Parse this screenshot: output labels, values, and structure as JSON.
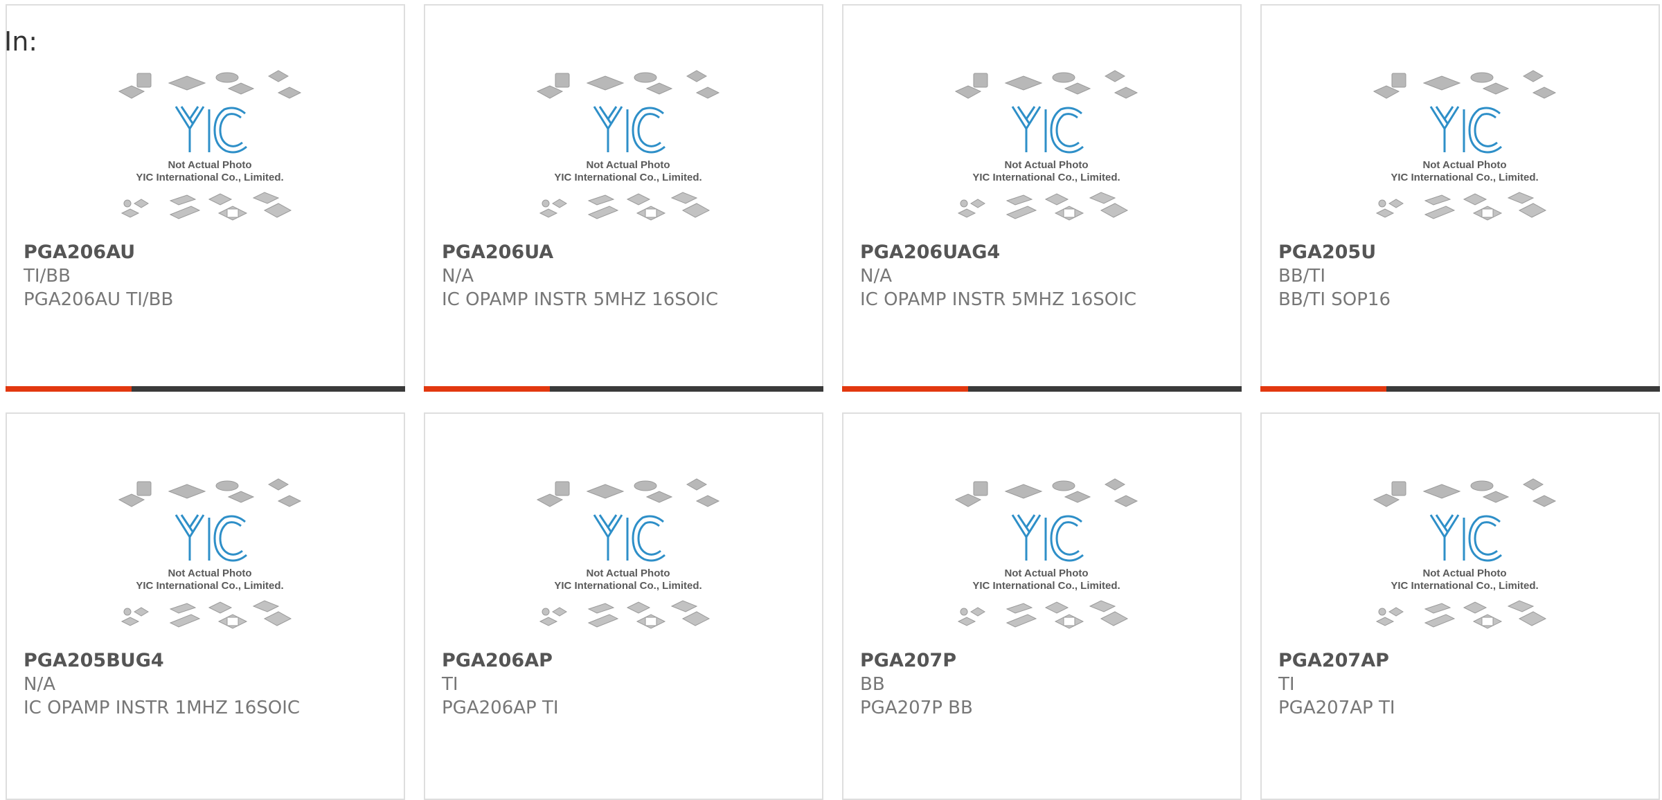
{
  "header": {
    "label": "In:"
  },
  "colors": {
    "accent": "#e2380f",
    "bar": "#3a3a3a",
    "logo": "#2e8fc8"
  },
  "watermark": {
    "logo_text": "YIC",
    "line1": "Not Actual Photo",
    "line2": "YIC International Co., Limited."
  },
  "products": [
    {
      "part": "PGA206AU",
      "manufacturer": "TI/BB",
      "description": "PGA206AU TI/BB"
    },
    {
      "part": "PGA206UA",
      "manufacturer": "N/A",
      "description": "IC OPAMP INSTR 5MHZ 16SOIC"
    },
    {
      "part": "PGA206UAG4",
      "manufacturer": "N/A",
      "description": "IC OPAMP INSTR 5MHZ 16SOIC"
    },
    {
      "part": "PGA205U",
      "manufacturer": "BB/TI",
      "description": "BB/TI SOP16"
    },
    {
      "part": "PGA205BUG4",
      "manufacturer": "N/A",
      "description": "IC OPAMP INSTR 1MHZ 16SOIC"
    },
    {
      "part": "PGA206AP",
      "manufacturer": "TI",
      "description": "PGA206AP TI"
    },
    {
      "part": "PGA207P",
      "manufacturer": "BB",
      "description": "PGA207P BB"
    },
    {
      "part": "PGA207AP",
      "manufacturer": "TI",
      "description": "PGA207AP TI"
    }
  ]
}
